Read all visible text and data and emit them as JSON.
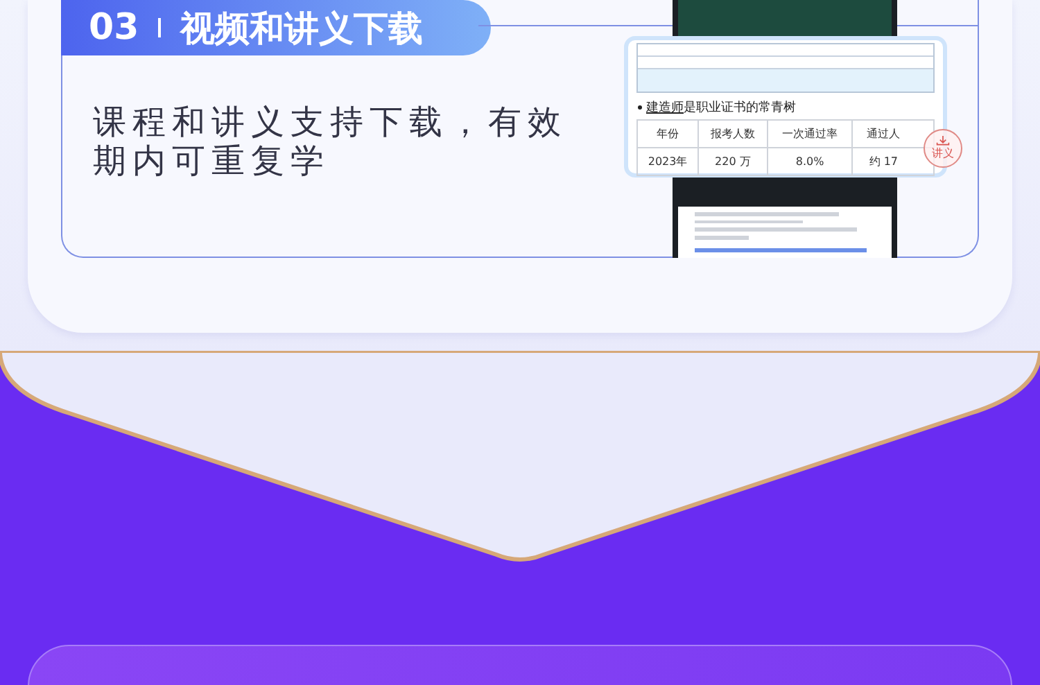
{
  "section": {
    "number": "03",
    "title": "视频和讲义下载",
    "description": "课程和讲义支持下载，有效期内可重复学"
  },
  "preview": {
    "heading_marked": "建造师",
    "heading_rest": "是职业证书的常青树",
    "columns": [
      "年份",
      "报考人数",
      "一次通过率",
      "通过人"
    ],
    "rows": [
      [
        "2023年",
        "220 万",
        "8.0%",
        "约 17"
      ]
    ],
    "stamp": "讲义"
  }
}
